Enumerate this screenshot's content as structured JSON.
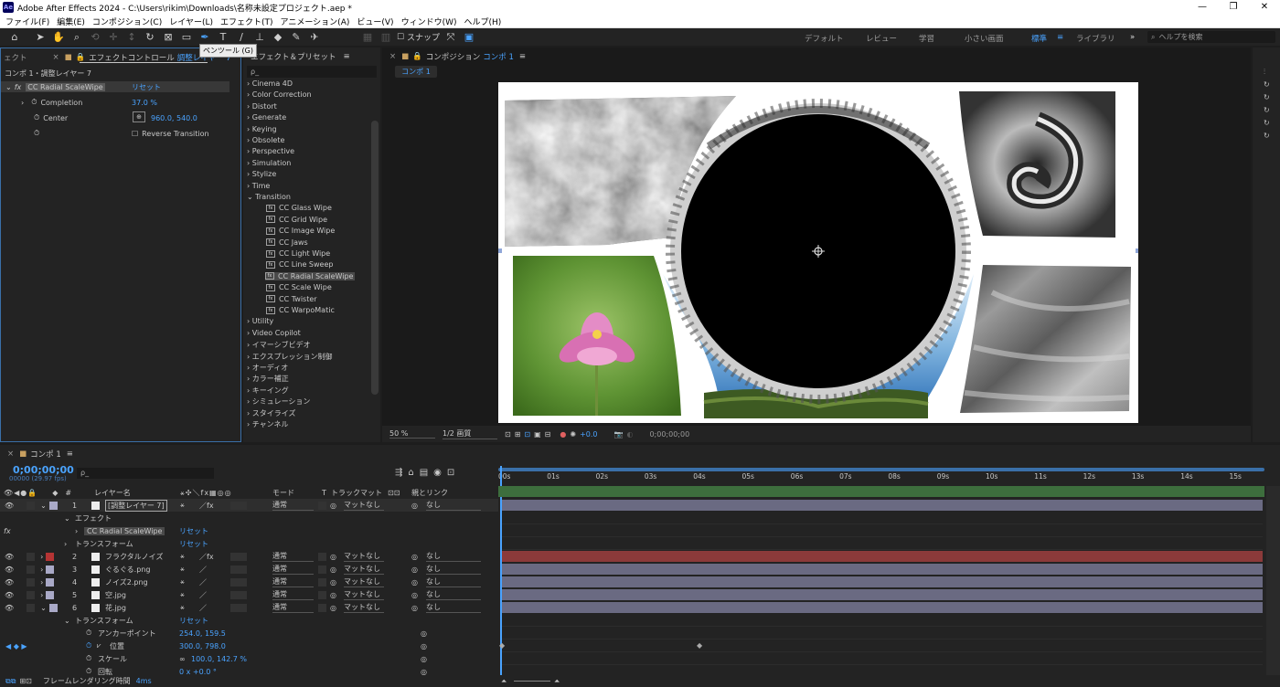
{
  "window": {
    "title": "Adobe After Effects 2024 - C:\\Users\\rikim\\Downloads\\名称未設定プロジェクト.aep *",
    "logo": "Ae"
  },
  "menu": [
    "ファイル(F)",
    "編集(E)",
    "コンポジション(C)",
    "レイヤー(L)",
    "エフェクト(T)",
    "アニメーション(A)",
    "ビュー(V)",
    "ウィンドウ(W)",
    "ヘルプ(H)"
  ],
  "toolbar": {
    "snap_label": "スナップ",
    "tooltip": "ペンツール (G)",
    "workspaces": [
      "デフォルト",
      "レビュー",
      "学習",
      "小さい画面",
      "標準",
      "ライブラリ"
    ],
    "active_workspace": "標準",
    "help_placeholder": "ヘルプを検索"
  },
  "effect_controls": {
    "tab_left": "ェクト",
    "tab_label": "エフェクトコントロール",
    "tab_layer": "調整レイヤー 7",
    "header": "コンポ 1・調整レイヤー 7",
    "effect_name": "CC Radial ScaleWipe",
    "reset": "リセット",
    "props": [
      {
        "name": "Completion",
        "value": "37.0 %"
      },
      {
        "name": "Center",
        "value": "960.0, 540.0"
      }
    ],
    "reverse_label": "Reverse Transition"
  },
  "effects_presets": {
    "title": "エフェクト＆プリセット",
    "search_placeholder": "ρ_",
    "categories_top": [
      "Cinema 4D",
      "Color Correction",
      "Distort",
      "Generate",
      "Keying",
      "Obsolete",
      "Perspective",
      "Simulation",
      "Stylize",
      "Time",
      "Transition"
    ],
    "transition_items": [
      "CC Glass Wipe",
      "CC Grid Wipe",
      "CC Image Wipe",
      "CC Jaws",
      "CC Light Wipe",
      "CC Line Sweep",
      "CC Radial ScaleWipe",
      "CC Scale Wipe",
      "CC Twister",
      "CC WarpoMatic"
    ],
    "selected_item": "CC Radial ScaleWipe",
    "categories_bottom": [
      "Utility",
      "Video Copilot",
      "イマーシブビデオ",
      "エクスプレッション制御",
      "オーディオ",
      "カラー補正",
      "キーイング",
      "シミュレーション",
      "スタイライズ",
      "チャンネル"
    ]
  },
  "composition": {
    "tab_prefix": "コンポジション",
    "tab_name": "コンポ 1",
    "sub_tab": "コンポ 1",
    "zoom": "50 %",
    "quality": "1/2 画質",
    "exposure": "+0.0",
    "timecode": "0;00;00;00"
  },
  "timeline": {
    "tab": "コンポ 1",
    "timecode": "0;00;00;00",
    "fps": "00000 (29.97 fps)",
    "search_placeholder": "ρ_",
    "headers": {
      "layer_name": "レイヤー名",
      "mode": "モード",
      "t": "T",
      "track_matte": "トラックマット",
      "parent": "親とリンク"
    },
    "ruler": [
      "00s",
      "01s",
      "02s",
      "03s",
      "04s",
      "05s",
      "06s",
      "07s",
      "08s",
      "09s",
      "10s",
      "11s",
      "12s",
      "13s",
      "14s",
      "15s"
    ],
    "layers": [
      {
        "num": "1",
        "name": "[調整レイヤー 7]",
        "color": "#a9a9c7",
        "mode": "通常",
        "matte": "マットなし",
        "parent": "なし"
      },
      {
        "num": "2",
        "name": "フラクタルノイズ",
        "color": "#b53434",
        "mode": "通常",
        "matte": "マットなし",
        "parent": "なし"
      },
      {
        "num": "3",
        "name": "ぐるぐる.png",
        "color": "#a9a9c7",
        "mode": "通常",
        "matte": "マットなし",
        "parent": "なし"
      },
      {
        "num": "4",
        "name": "ノイズ2.png",
        "color": "#a9a9c7",
        "mode": "通常",
        "matte": "マットなし",
        "parent": "なし"
      },
      {
        "num": "5",
        "name": "空.jpg",
        "color": "#a9a9c7",
        "mode": "通常",
        "matte": "マットなし",
        "parent": "なし"
      },
      {
        "num": "6",
        "name": "花.jpg",
        "color": "#a9a9c7",
        "mode": "通常",
        "matte": "マットなし",
        "parent": "なし"
      }
    ],
    "effect_group": "エフェクト",
    "effect_name": "CC Radial ScaleWipe",
    "transform_group": "トランスフォーム",
    "reset": "リセット",
    "transform_props": [
      {
        "name": "アンカーポイント",
        "value": "254.0, 159.5"
      },
      {
        "name": "位置",
        "value": "300.0, 798.0"
      },
      {
        "name": "スケール",
        "value": "100.0, 142.7 %"
      },
      {
        "name": "回転",
        "value": "0 x +0.0 °"
      }
    ],
    "render_time_label": "フレームレンダリング時間",
    "render_time": "4ms"
  }
}
